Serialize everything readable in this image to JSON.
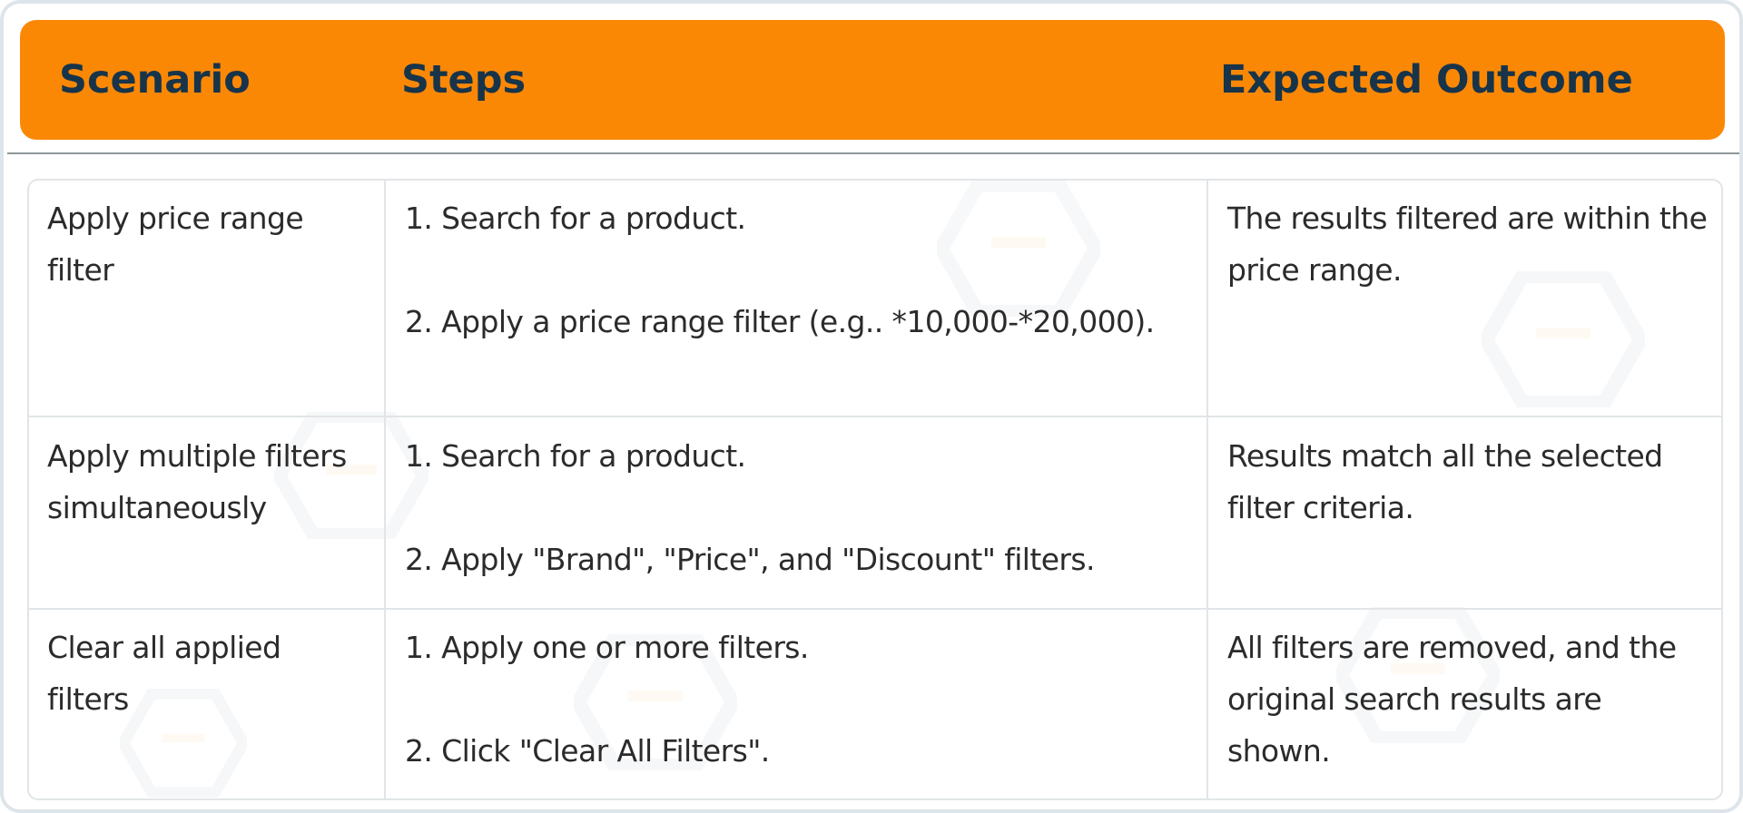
{
  "table": {
    "headers": [
      "Scenario",
      "Steps",
      "Expected Outcome"
    ],
    "rows": [
      {
        "scenario": "Apply price range filter",
        "steps": [
          "1. Search for a product.",
          "2. Apply a price range filter (e.g.. *10,000-*20,000)."
        ],
        "outcome": "The results filtered are within the price range."
      },
      {
        "scenario": "Apply multiple filters simultaneously",
        "steps": [
          "1. Search for a product.",
          "2. Apply \"Brand\", \"Price\", and \"Discount\" filters."
        ],
        "outcome": "Results match all the selected filter criteria."
      },
      {
        "scenario": "Clear all applied filters",
        "steps": [
          "1. Apply one or more filters.",
          "2. Click \"Clear All Filters\"."
        ],
        "outcome": "All filters are removed, and the original search results are shown."
      }
    ]
  },
  "colors": {
    "header_background": "#fb8805",
    "header_text": "#17344a",
    "body_text": "#2b2b2b",
    "grid": "#e1e5e8"
  },
  "icons": [
    "hexagon-logo-watermark-icon"
  ]
}
